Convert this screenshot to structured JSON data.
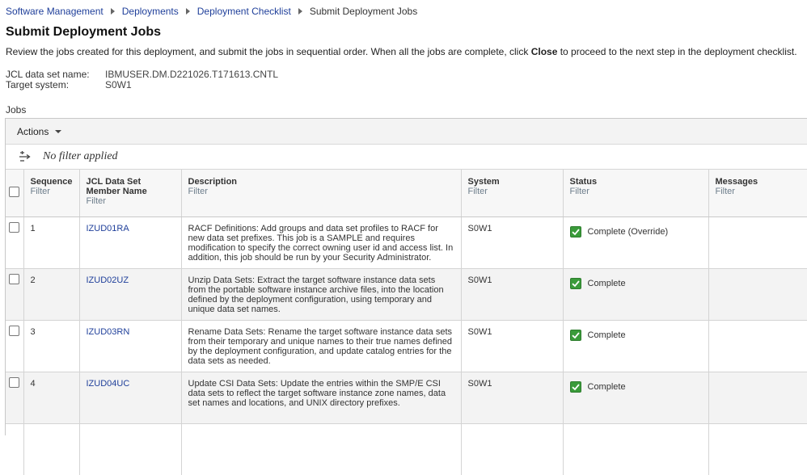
{
  "breadcrumb": {
    "items": [
      "Software Management",
      "Deployments",
      "Deployment Checklist"
    ],
    "current": "Submit Deployment Jobs"
  },
  "page_title": "Submit Deployment Jobs",
  "intro": {
    "before": "Review the jobs created for this deployment, and submit the jobs in sequential order. When all the jobs are complete, click ",
    "bold": "Close",
    "after": " to proceed to the next step in the deployment checklist."
  },
  "info": {
    "jcl_label": "JCL data set name:",
    "jcl_value": "IBMUSER.DM.D221026.T171613.CNTL",
    "system_label": "Target system:",
    "system_value": "S0W1"
  },
  "jobs_label": "Jobs",
  "toolbar": {
    "actions_label": "Actions"
  },
  "filter_status": "No filter applied",
  "columns": {
    "sequence": "Sequence",
    "member": "JCL Data Set Member Name",
    "description": "Description",
    "system": "System",
    "status": "Status",
    "messages": "Messages",
    "filter": "Filter"
  },
  "rows": [
    {
      "sequence": "1",
      "member": "IZUD01RA",
      "description": "RACF Definitions: Add groups and data set profiles to RACF for new data set prefixes. This job is a SAMPLE and requires modification to specify the correct owning user id and access list. In addition, this job should be run by your Security Administrator.",
      "system": "S0W1",
      "status": "Complete (Override)",
      "messages": ""
    },
    {
      "sequence": "2",
      "member": "IZUD02UZ",
      "description": "Unzip Data Sets: Extract the target software instance data sets from the portable software instance archive files, into the location defined by the deployment configuration, using temporary and unique data set names.",
      "system": "S0W1",
      "status": "Complete",
      "messages": ""
    },
    {
      "sequence": "3",
      "member": "IZUD03RN",
      "description": "Rename Data Sets: Rename the target software instance data sets from their temporary and unique names to their true names defined by the deployment configuration, and update catalog entries for the data sets as needed.",
      "system": "S0W1",
      "status": "Complete",
      "messages": ""
    },
    {
      "sequence": "4",
      "member": "IZUD04UC",
      "description": "Update CSI Data Sets: Update the entries within the SMP/E CSI data sets to reflect the target software instance zone names, data set names and locations, and UNIX directory prefixes.",
      "system": "S0W1",
      "status": "Complete",
      "messages": ""
    }
  ],
  "colors": {
    "link": "#1f3f9a",
    "status_complete": "#3a9b3a",
    "filter_link": "#6e7e8c"
  },
  "icons": {
    "breadcrumb_separator": "triangle-right-icon",
    "actions_caret": "chevron-down-icon",
    "filter": "filter-sort-icon",
    "status": "checkmark-icon"
  }
}
